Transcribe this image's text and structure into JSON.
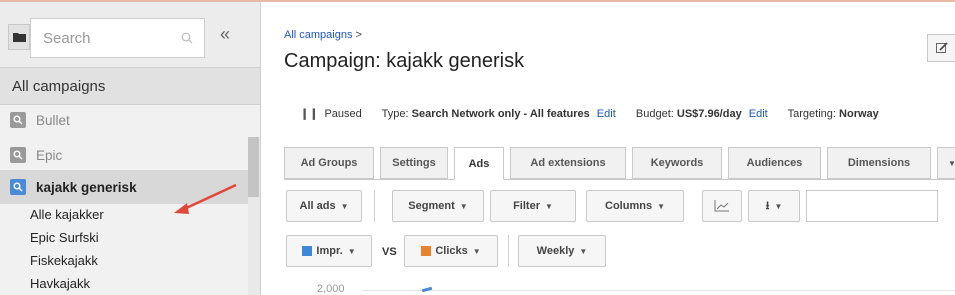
{
  "sidebar": {
    "search_placeholder": "Search",
    "collapse_label": "«",
    "all_campaigns_label": "All campaigns",
    "campaigns": [
      {
        "label": "Bullet",
        "selected": false
      },
      {
        "label": "Epic",
        "selected": false
      },
      {
        "label": "kajakk generisk",
        "selected": true
      }
    ],
    "ad_groups": [
      "Alle kajakker",
      "Epic Surfski",
      "Fiskekajakk",
      "Havkajakk"
    ]
  },
  "header": {
    "breadcrumb_link": "All campaigns",
    "breadcrumb_separator": ">",
    "title_prefix": "Campaign:",
    "title_name": "kajakk generisk"
  },
  "info": {
    "status_icon": "❙❙",
    "status": "Paused",
    "type_label": "Type:",
    "type_value": "Search Network only - All features",
    "type_edit": "Edit",
    "budget_label": "Budget:",
    "budget_value": "US$7.96/day",
    "budget_edit": "Edit",
    "targeting_label": "Targeting:",
    "targeting_value": "Norway"
  },
  "tabs": [
    "Ad Groups",
    "Settings",
    "Ads",
    "Ad extensions",
    "Keywords",
    "Audiences",
    "Dimensions"
  ],
  "active_tab": "Ads",
  "toolbar": {
    "all_ads": "All ads",
    "segment": "Segment",
    "filter": "Filter",
    "columns": "Columns",
    "download_icon": "⭳"
  },
  "chart_controls": {
    "metric1": "Impr.",
    "metric1_color": "#3d87d8",
    "vs": "VS",
    "metric2": "Clicks",
    "metric2_color": "#e8822d",
    "period": "Weekly"
  },
  "chart": {
    "y_tick": "2,000"
  },
  "colors": {
    "link": "#1a55c8",
    "selected_campaign_icon": "#4a8bd8",
    "annotation_arrow": "#e2483a"
  }
}
